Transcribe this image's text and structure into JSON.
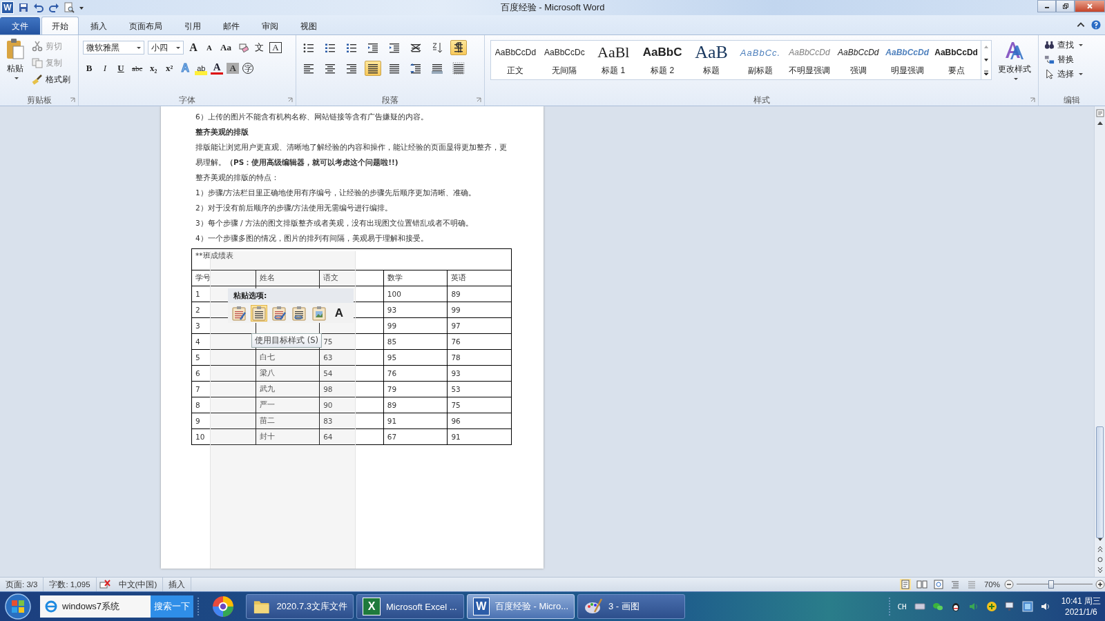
{
  "title_bar": {
    "logo": "W",
    "title": "百度经验 - Microsoft Word"
  },
  "ribbon_tabs": [
    {
      "label": "文件",
      "kind": "file",
      "selected": false
    },
    {
      "label": "开始",
      "kind": "tab",
      "selected": true
    },
    {
      "label": "插入",
      "kind": "tab",
      "selected": false
    },
    {
      "label": "页面布局",
      "kind": "tab",
      "selected": false
    },
    {
      "label": "引用",
      "kind": "tab",
      "selected": false
    },
    {
      "label": "邮件",
      "kind": "tab",
      "selected": false
    },
    {
      "label": "审阅",
      "kind": "tab",
      "selected": false
    },
    {
      "label": "视图",
      "kind": "tab",
      "selected": false
    }
  ],
  "clipboard": {
    "paste": "粘贴",
    "items": [
      {
        "label": "剪切",
        "kind": "cut",
        "disabled": true
      },
      {
        "label": "复制",
        "kind": "copy",
        "disabled": true
      },
      {
        "label": "格式刷",
        "kind": "painter",
        "disabled": false
      }
    ],
    "label": "剪贴板"
  },
  "font": {
    "name": "微软雅黑",
    "size": "小四",
    "buttons_top": [
      {
        "glyph": "A",
        "kind": "grow"
      },
      {
        "glyph": "A",
        "kind": "shrink"
      },
      {
        "glyph": "Aa",
        "kind": "case"
      },
      {
        "kind": "clear"
      },
      {
        "glyph": "文",
        "kind": "phonetic"
      },
      {
        "glyph": "A",
        "kind": "boxed"
      }
    ],
    "buttons_bottom": [
      {
        "glyph": "B",
        "kind": "bold"
      },
      {
        "glyph": "I",
        "kind": "italic"
      },
      {
        "glyph": "U",
        "kind": "underline"
      },
      {
        "glyph": "abc",
        "kind": "strike"
      },
      {
        "glyph": "x₂",
        "kind": "sub"
      },
      {
        "glyph": "x²",
        "kind": "sup"
      },
      {
        "glyph": "A",
        "kind": "effects"
      },
      {
        "glyph": "ab",
        "kind": "highlight"
      },
      {
        "glyph": "A",
        "kind": "color"
      },
      {
        "glyph": "A",
        "kind": "shade"
      },
      {
        "glyph": "字",
        "kind": "enclose"
      }
    ],
    "label": "字体"
  },
  "paragraph": {
    "buttons_top": [
      {
        "kind": "bullets",
        "selected": false
      },
      {
        "kind": "numbering",
        "selected": false
      },
      {
        "kind": "multilevel",
        "selected": false
      },
      {
        "kind": "outdent",
        "selected": false
      },
      {
        "kind": "indent",
        "selected": false
      },
      {
        "kind": "asian",
        "selected": false
      },
      {
        "kind": "sort",
        "selected": false
      },
      {
        "kind": "marks",
        "selected": true
      }
    ],
    "buttons_bottom": [
      {
        "kind": "left",
        "selected": false
      },
      {
        "kind": "center",
        "selected": false
      },
      {
        "kind": "right",
        "selected": false
      },
      {
        "kind": "justify",
        "selected": true
      },
      {
        "kind": "distribute",
        "selected": false
      },
      {
        "kind": "spacing",
        "selected": false
      },
      {
        "kind": "shading",
        "selected": false
      },
      {
        "kind": "borders",
        "selected": false
      }
    ],
    "label": "段落"
  },
  "styles": {
    "items": [
      {
        "preview": "AaBbCcDd",
        "name": "正文",
        "kind": "normal"
      },
      {
        "preview": "AaBbCcDc",
        "name": "无间隔",
        "kind": "nospacing"
      },
      {
        "preview": "AaBl",
        "name": "标题 1",
        "kind": "heading1"
      },
      {
        "preview": "AaBbC",
        "name": "标题 2",
        "kind": "heading2"
      },
      {
        "preview": "AaB",
        "name": "标题",
        "kind": "title"
      },
      {
        "preview": "AaBbCc.",
        "name": "副标题",
        "kind": "subtitle"
      },
      {
        "preview": "AaBbCcDd",
        "name": "不明显强调",
        "kind": "subtle"
      },
      {
        "preview": "AaBbCcDd",
        "name": "强调",
        "kind": "emphasis"
      },
      {
        "preview": "AaBbCcDd",
        "name": "明显强调",
        "kind": "intense"
      },
      {
        "preview": "AaBbCcDd",
        "name": "要点",
        "kind": "strong"
      }
    ],
    "change_styles": "更改样式",
    "label": "样式"
  },
  "editing": {
    "items": [
      {
        "label": "查找",
        "kind": "find"
      },
      {
        "label": "替换",
        "kind": "replace"
      },
      {
        "label": "选择",
        "kind": "select"
      }
    ],
    "label": "编辑"
  },
  "document": {
    "paragraphs": [
      {
        "text": "6）上传的图片不能含有机构名称、网站链接等含有广告嫌疑的内容。",
        "bold": false
      },
      {
        "text": "整齐美观的排版",
        "bold": true
      },
      {
        "text": "排版能让浏览用户更直观、清晰地了解经验的内容和操作，能让经验的页面显得更加整齐，更",
        "bold": false
      },
      {
        "text": "易理解。**（PS：使用高级编辑器，就可以考虑这个问题啦!!)**",
        "bold": false
      },
      {
        "text": "整齐美观的排版的特点：",
        "bold": false
      },
      {
        "text": "1）步骤/方法栏目里正确地使用有序编号，让经验的步骤先后顺序更加清晰、准确。",
        "bold": false
      },
      {
        "text": "2）对于没有前后顺序的步骤/方法使用无需编号进行编排。",
        "bold": false
      },
      {
        "text": "3）每个步骤 / 方法的图文排版整齐或者美观，没有出现图文位置错乱或者不明确。",
        "bold": false
      },
      {
        "text": "4）一个步骤多图的情况，图片的排列有间隔，美观易于理解和接受。",
        "bold": false
      }
    ],
    "table": {
      "title": "**班成绩表",
      "columns": [
        "学号",
        "姓名",
        "语文",
        "数学",
        "英语"
      ],
      "rows": [
        [
          "1",
          null,
          null,
          "100",
          "89"
        ],
        [
          "2",
          null,
          null,
          "93",
          "99"
        ],
        [
          "3",
          null,
          null,
          "99",
          "97"
        ],
        [
          "4",
          null,
          "75",
          "85",
          "76"
        ],
        [
          "5",
          "白七",
          "63",
          "95",
          "78"
        ],
        [
          "6",
          "梁八",
          "54",
          "76",
          "93"
        ],
        [
          "7",
          "武九",
          "98",
          "79",
          "53"
        ],
        [
          "8",
          "严一",
          "90",
          "89",
          "75"
        ],
        [
          "9",
          "苗二",
          "83",
          "91",
          "96"
        ],
        [
          "10",
          "封十",
          "64",
          "67",
          "91"
        ]
      ]
    }
  },
  "paste_options": {
    "title": "粘贴选项:",
    "buttons": [
      {
        "kind": "keep",
        "selected": false
      },
      {
        "kind": "destination",
        "selected": true
      },
      {
        "kind": "merge",
        "selected": false
      },
      {
        "kind": "link",
        "selected": false
      },
      {
        "kind": "picture",
        "selected": false
      },
      {
        "kind": "text",
        "label": "A",
        "selected": false
      }
    ],
    "tooltip": "使用目标样式 (S)"
  },
  "status_bar": {
    "items": [
      "页面: 3/3",
      "字数: 1,095",
      "中文(中国)",
      "插入"
    ],
    "zoom": "70%",
    "zoom_slider": {
      "level": 0.45
    }
  },
  "taskbar": {
    "search": {
      "value": "windows7系统",
      "button": "搜索一下"
    },
    "tasks": [
      {
        "label": "2020.7.3文库文件",
        "kind": "folder",
        "selected": false
      },
      {
        "label": "Microsoft Excel ...",
        "kind": "excel",
        "logo": "X",
        "selected": false
      },
      {
        "label": "百度经验 - Micro...",
        "kind": "word",
        "logo": "W",
        "selected": true
      },
      {
        "label": "3 - 画图",
        "kind": "paint",
        "selected": false
      }
    ],
    "tray": {
      "language": "CH",
      "time": "10:41 周三",
      "date": "2021/1/6"
    }
  }
}
